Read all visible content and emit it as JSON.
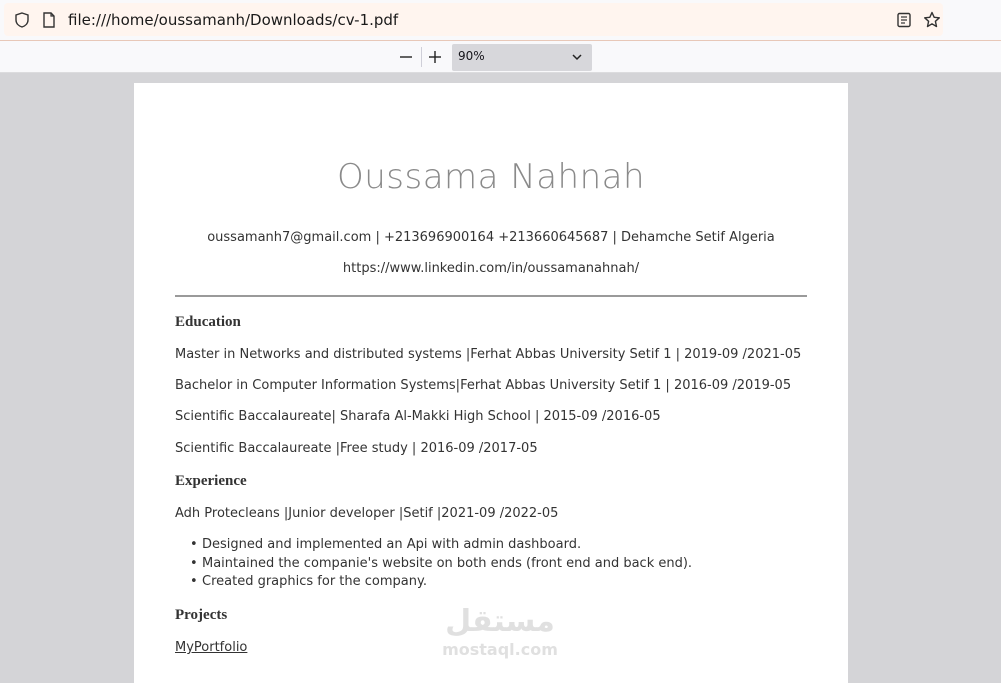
{
  "browser": {
    "url": "file:///home/oussamanh/Downloads/cv-1.pdf"
  },
  "pdf_toolbar": {
    "zoom_value": "90%"
  },
  "cv": {
    "name": "Oussama Nahnah",
    "contact": "oussamanh7@gmail.com | +213696900164 +213660645687 | Dehamche Setif Algeria",
    "linkedin": "https://www.linkedin.com/in/oussamanahnah/",
    "education": {
      "heading": "Education",
      "items": [
        "Master in Networks and distributed systems |Ferhat Abbas University Setif 1 | 2019-09 /2021-05",
        "Bachelor in Computer Information Systems|Ferhat Abbas University Setif 1 | 2016-09 /2019-05",
        "Scientific Baccalaureate| Sharafa Al-Makki High School | 2015-09 /2016-05",
        "Scientific Baccalaureate |Free study | 2016-09 /2017-05"
      ]
    },
    "experience": {
      "heading": "Experience",
      "job": "Adh Protecleans |Junior developer |Setif |2021-09 /2022-05",
      "bullets": [
        "Designed and implemented an Api with admin dashboard.",
        "Maintained the companie's website on both ends (front end and back end).",
        "Created graphics for the company."
      ]
    },
    "projects": {
      "heading": "Projects",
      "items": [
        "MyPortfolio"
      ]
    }
  },
  "watermark": {
    "arabic": "مستقل",
    "latin": "mostaql.com"
  }
}
